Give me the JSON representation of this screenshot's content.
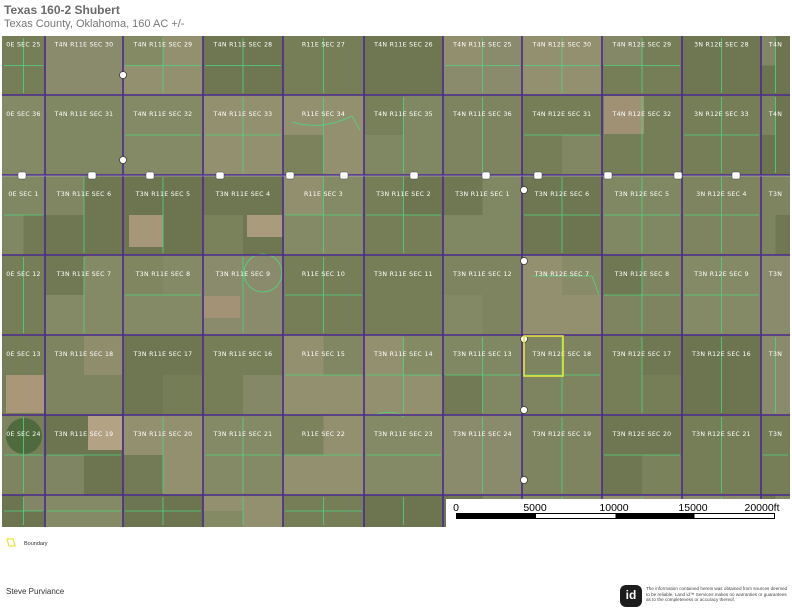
{
  "title": "Texas 160-2 Shubert",
  "subtitle": "Texas County, Oklahoma, 160 AC +/-",
  "map": {
    "section_labels": [
      [
        "0E SEC 25",
        "T4N R11E SEC 30",
        "T4N R11E SEC 29",
        "T4N R11E SEC 28",
        "R11E SEC 27",
        "T4N R11E SEC 26",
        "T4N R11E SEC 25",
        "T4N R12E SEC 30",
        "T4N R12E SEC 29",
        "3N R12E SEC 28",
        "T4N"
      ],
      [
        "0E SEC 36",
        "T4N R11E SEC 31",
        "T4N R11E SEC 32",
        "T4N R11E SEC 33",
        "R11E SEC 34",
        "T4N R11E SEC 35",
        "T4N R11E SEC 36",
        "T4N R12E SEC 31",
        "T4N R12E SEC 32",
        "3N R12E SEC 33",
        "T4N"
      ],
      [
        "0E SEC 1",
        "T3N R11E SEC 6",
        "T3N R11E SEC 5",
        "T3N R11E SEC 4",
        "R11E SEC 3",
        "T3N R11E SEC 2",
        "T3N R11E SEC 1",
        "T3N R12E SEC 6",
        "T3N R12E SEC 5",
        "3N R12E SEC 4",
        "T3N"
      ],
      [
        "0E SEC 12",
        "T3N R11E SEC 7",
        "T3N R11E SEC 8",
        "T3N R11E SEC 9",
        "R11E SEC 10",
        "T3N R11E SEC 11",
        "T3N R11E SEC 12",
        "T3N R12E SEC 7",
        "T3N R12E SEC 8",
        "T3N R12E SEC 9",
        "T3N"
      ],
      [
        "0E SEC 13",
        "T3N R11E SEC 18",
        "T3N R11E SEC 17",
        "T3N R11E SEC 16",
        "R11E SEC 15",
        "T3N R11E SEC 14",
        "T3N R11E SEC 13",
        "T3N R12E SEC 18",
        "T3N R12E SEC 17",
        "T3N R12E SEC 16",
        "T3N"
      ],
      [
        "0E SEC 24",
        "T3N R11E SEC 19",
        "T3N R11E SEC 20",
        "T3N R11E SEC 21",
        "R11E SEC 22",
        "T3N R11E SEC 23",
        "T3N R11E SEC 24",
        "T3N R12E SEC 19",
        "T3N R12E SEC 20",
        "T3N R12E SEC 21",
        "T3N"
      ]
    ],
    "colors": {
      "section_line": "#4b2a8c",
      "parcel_line": "#4fd67e",
      "boundary": "#e7e43a"
    }
  },
  "scale": {
    "ticks": [
      "0",
      "5000",
      "10000",
      "15000",
      "20000ft"
    ]
  },
  "legend": {
    "boundary_label": "Boundary",
    "boundary_color": "#e7e43a"
  },
  "footer": {
    "author": "Steve Purviance",
    "logo_text": "id",
    "disclaimer": "The information contained herein was obtained from sources deemed to be reliable. Land id™ Services makes no warranties or guarantees as to the completeness or accuracy thereof."
  }
}
